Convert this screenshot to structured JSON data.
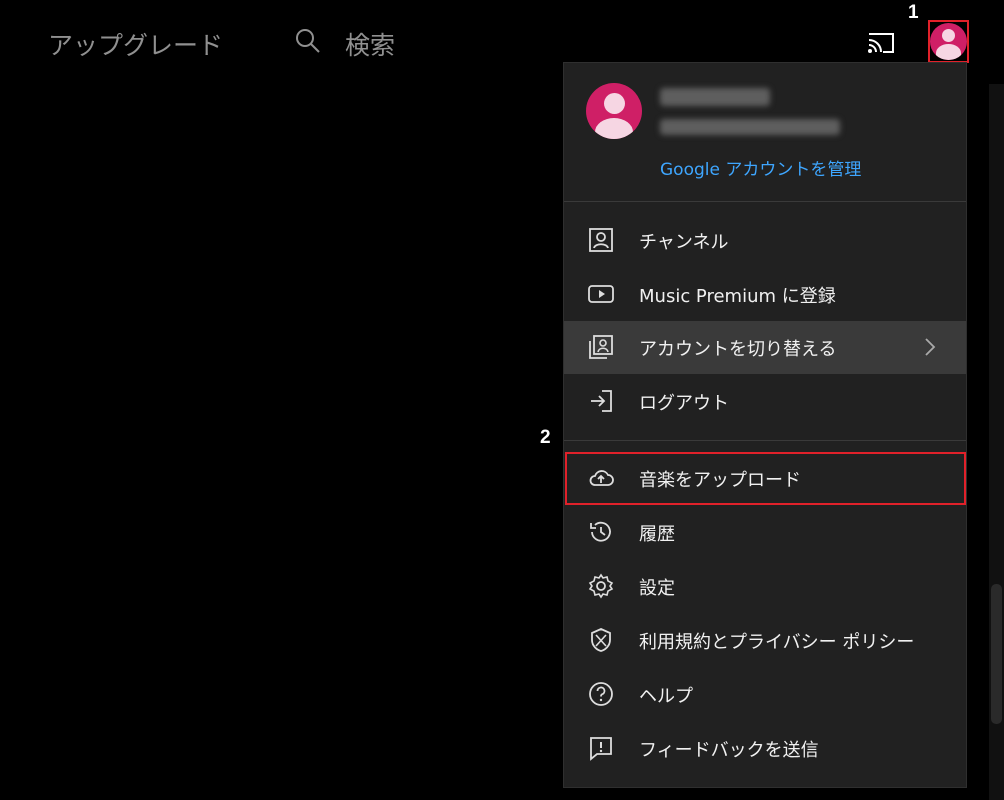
{
  "header": {
    "upgrade_label": "アップグレード",
    "search_label": "検索"
  },
  "profile": {
    "manage_account_link": "Google アカウントを管理"
  },
  "menu": {
    "items": [
      {
        "label": "チャンネル",
        "icon": "account-box-icon"
      },
      {
        "label": "Music Premium に登録",
        "icon": "youtube-play-icon"
      },
      {
        "label": "アカウントを切り替える",
        "icon": "switch-account-icon"
      },
      {
        "label": "ログアウト",
        "icon": "exit-icon"
      },
      {
        "label": "音楽をアップロード",
        "icon": "cloud-upload-icon"
      },
      {
        "label": "履歴",
        "icon": "history-icon"
      },
      {
        "label": "設定",
        "icon": "gear-icon"
      },
      {
        "label": "利用規約とプライバシー ポリシー",
        "icon": "shield-icon"
      },
      {
        "label": "ヘルプ",
        "icon": "help-icon"
      },
      {
        "label": "フィードバックを送信",
        "icon": "feedback-icon"
      }
    ]
  },
  "annotations": {
    "step1": "1",
    "step2": "2"
  },
  "colors": {
    "accent_link": "#3ea6ff",
    "avatar_bg": "#cf1f66",
    "highlight_box": "#e1212a",
    "menu_bg": "#212121"
  }
}
